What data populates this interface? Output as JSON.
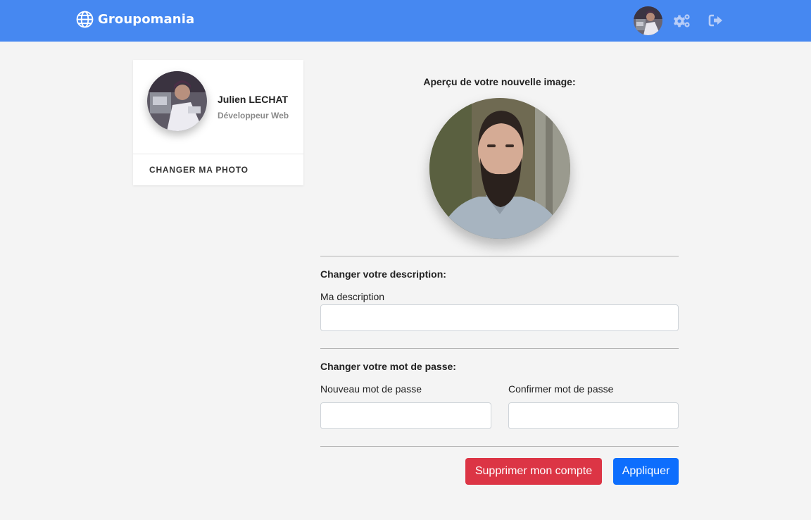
{
  "app": {
    "brand": "Groupomania"
  },
  "navbar": {
    "avatar_alt": "Photo de profil",
    "settings_icon": "gears-icon",
    "logout_icon": "sign-out-icon",
    "brand_icon": "globe-icon"
  },
  "profile_card": {
    "name": "Julien LECHAT",
    "job": "Développeur Web",
    "change_photo": "CHANGER MA PHOTO"
  },
  "preview": {
    "label": "Aperçu de votre nouvelle image:"
  },
  "description": {
    "section_title": "Changer votre description:",
    "label": "Ma description",
    "value": "",
    "placeholder": ""
  },
  "password": {
    "section_title": "Changer votre mot de passe:",
    "new_label": "Nouveau mot de passe",
    "new_value": "",
    "confirm_label": "Confirmer mot de passe",
    "confirm_value": ""
  },
  "actions": {
    "delete": "Supprimer mon compte",
    "apply": "Appliquer"
  },
  "colors": {
    "navbar": "#4688f1",
    "danger": "#dc3545",
    "primary": "#0d6efd",
    "background": "#f4f4f4"
  }
}
